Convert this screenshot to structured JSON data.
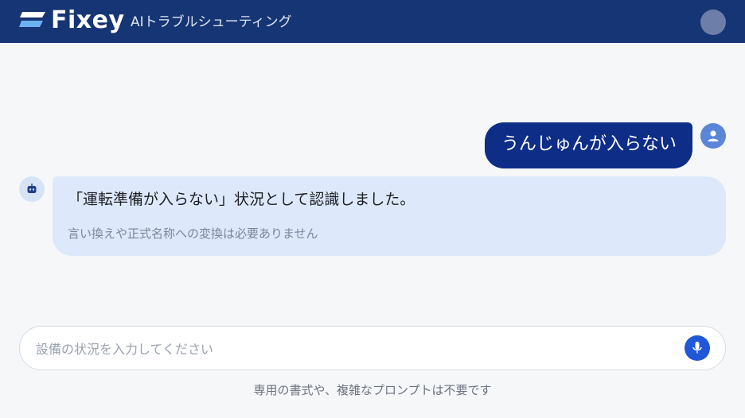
{
  "header": {
    "brand": "Fixey",
    "subtitle": "AIトラブルシューティング",
    "logo_icon": "fixey-logo-icon",
    "avatar_icon": "user-avatar-icon"
  },
  "chat": {
    "messages": [
      {
        "role": "user",
        "text": "うんじゅんが入らない",
        "avatar_icon": "user-icon"
      },
      {
        "role": "assistant",
        "text": "「運転準備が入らない」状況として認識しました。",
        "note": "言い換えや正式名称への変換は必要ありません",
        "avatar_icon": "robot-icon"
      }
    ]
  },
  "composer": {
    "placeholder": "設備の状況を入力してください",
    "value": "",
    "mic_icon": "microphone-icon"
  },
  "hint": "専用の書式や、複雑なプロンプトは不要です",
  "colors": {
    "header_bg": "#163574",
    "user_bubble": "#0e2d86",
    "bot_bubble": "#dde9fb",
    "accent": "#1f57d6"
  }
}
